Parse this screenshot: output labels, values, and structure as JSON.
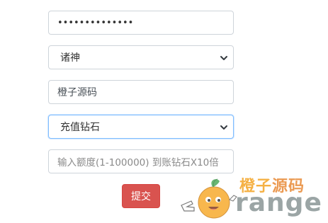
{
  "form": {
    "password": {
      "value": "••••••••••••••"
    },
    "server_select": {
      "selected": "诸神"
    },
    "site_name": {
      "value": "橙子源码"
    },
    "recharge_type": {
      "selected": "充值钻石"
    },
    "amount": {
      "placeholder": "输入额度(1-100000) 到账钻石X10倍"
    },
    "submit_label": "提交"
  },
  "watermark": {
    "cn_part1": "橙子",
    "cn_part2": "源码",
    "en_text": "range"
  },
  "colors": {
    "submit_bg": "#d9534f",
    "focus_border": "#80bdff",
    "watermark_orange": "#f39c12",
    "watermark_gray": "#7f8c8d"
  }
}
